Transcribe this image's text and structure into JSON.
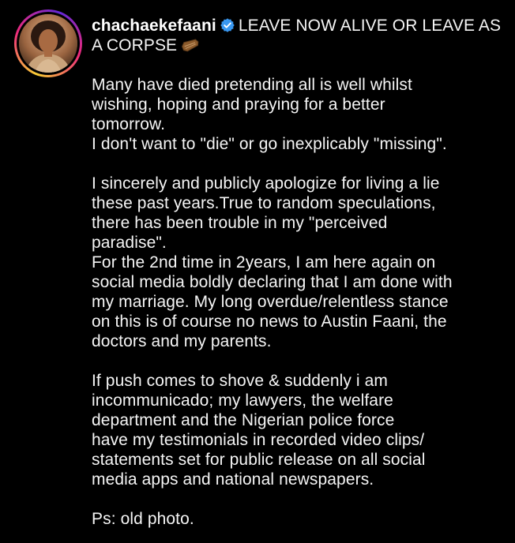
{
  "post": {
    "username": "chachaekefaani",
    "headline": "LEAVE NOW ALIVE OR LEAVE AS A CORPSE",
    "verified_icon": "verified-badge-icon",
    "headline_emoji": "coffin-icon",
    "lines": [
      "Many have died pretending all is well whilst",
      "wishing, hoping and praying for a better",
      "tomorrow.",
      "I don't want to \"die\" or go inexplicably \"missing\".",
      "",
      "I sincerely and publicly apologize for living a lie",
      "these past years.True to random speculations,",
      "there has been trouble in my \"perceived",
      "paradise\".",
      "For the 2nd time in 2years, I am here again on",
      "social media boldly declaring that I am done with",
      "my marriage. My long overdue/relentless stance",
      "on this is of course no news to Austin Faani, the",
      "doctors and my parents.",
      "",
      "If push comes to shove & suddenly i am",
      "incommunicado; my lawyers, the welfare",
      "department and the Nigerian police force",
      "have my testimonials in recorded video clips/",
      "statements set for public release on all social",
      "media apps and national newspapers.",
      "",
      "Ps: old photo."
    ]
  },
  "colors": {
    "background": "#000000",
    "text": "#f5f5f5",
    "verified": "#3897f0"
  }
}
